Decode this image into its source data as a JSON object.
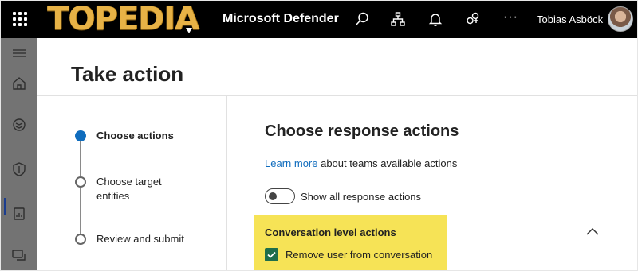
{
  "header": {
    "logo_text": "TOPEDIA",
    "app_title": "Microsoft Defender",
    "user_name": "Tobias Asböck",
    "more": "···"
  },
  "rail": {
    "items": [
      "menu-icon",
      "home-icon",
      "incidents-icon",
      "shield-icon",
      "reports-icon",
      "chat-icon"
    ],
    "active": "shield-icon"
  },
  "page": {
    "title": "Take action"
  },
  "steps": [
    {
      "label": "Choose actions",
      "state": "current"
    },
    {
      "label": "Choose target entities",
      "state": "pending"
    },
    {
      "label": "Review and submit",
      "state": "pending"
    }
  ],
  "panel": {
    "title": "Choose response actions",
    "learn_link": "Learn more",
    "learn_text": " about teams available actions",
    "toggle_label": "Show all response actions",
    "toggle_on": false,
    "conversation": {
      "title": "Conversation level actions",
      "expanded": true,
      "checkbox_label": "Remove user from conversation",
      "checked": true
    }
  },
  "colors": {
    "accent": "#0f6cbd",
    "checkbox": "#1e6e4b",
    "highlight": "#f6e356",
    "logo": "#e7b246"
  }
}
